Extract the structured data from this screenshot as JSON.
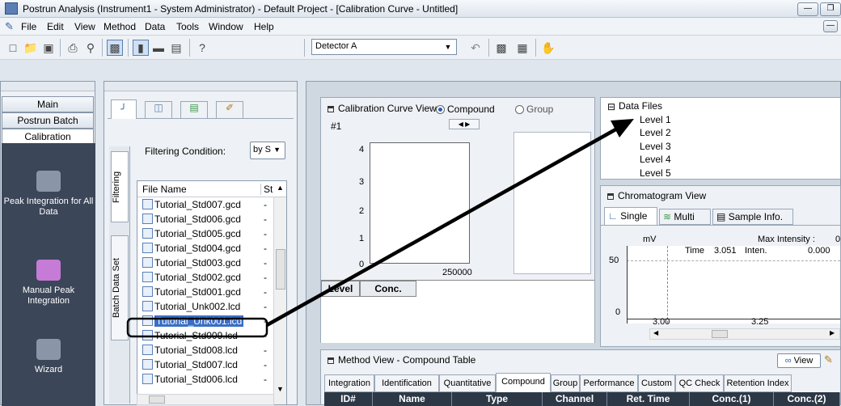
{
  "window": {
    "title": "Postrun Analysis (Instrument1 - System Administrator) - Default Project - [Calibration Curve - Untitled]"
  },
  "menu": [
    "File",
    "Edit",
    "View",
    "Method",
    "Data",
    "Tools",
    "Window",
    "Help"
  ],
  "toolbar": {
    "detector": "Detector A",
    "help": "?"
  },
  "nav": {
    "main": "Main",
    "postrun_batch": "Postrun Batch",
    "calibration": "Calibration",
    "items": [
      "Peak Integration for All Data",
      "Manual Peak Integration",
      "Wizard"
    ]
  },
  "filter": {
    "label": "Filtering Condition:",
    "value": "by S",
    "tab_filtering": "Filtering",
    "tab_batch": "Batch Data Set"
  },
  "files": {
    "col_name": "File Name",
    "col_st": "St",
    "rows": [
      {
        "name": "Tutorial_Std007.gcd",
        "st": "-"
      },
      {
        "name": "Tutorial_Std006.gcd",
        "st": "-"
      },
      {
        "name": "Tutorial_Std005.gcd",
        "st": "-"
      },
      {
        "name": "Tutorial_Std004.gcd",
        "st": "-"
      },
      {
        "name": "Tutorial_Std003.gcd",
        "st": "-"
      },
      {
        "name": "Tutorial_Std002.gcd",
        "st": "-"
      },
      {
        "name": "Tutorial_Std001.gcd",
        "st": "-"
      },
      {
        "name": "Tutorial_Unk002.lcd",
        "st": "-"
      },
      {
        "name": "Tutorial_Unk001.lcd",
        "st": "-"
      },
      {
        "name": "Tutorial_Std009.lcd",
        "st": "-"
      },
      {
        "name": "Tutorial_Std008.lcd",
        "st": "-"
      },
      {
        "name": "Tutorial_Std007.lcd",
        "st": "-"
      },
      {
        "name": "Tutorial_Std006.lcd",
        "st": "-"
      }
    ]
  },
  "calib": {
    "title": "Calibration Curve View",
    "compound": "Compound",
    "group": "Group",
    "id": "#1",
    "yticks": [
      "4",
      "3",
      "2",
      "1",
      "0"
    ],
    "xtick": "250000",
    "grid_level": "Level",
    "grid_conc": "Conc."
  },
  "tree": {
    "root": "Data Files",
    "levels": [
      "Level 1",
      "Level 2",
      "Level 3",
      "Level 4",
      "Level 5"
    ]
  },
  "chrom": {
    "title": "Chromatogram View",
    "tab_single": "Single",
    "tab_multi": "Multi",
    "tab_sample": "Sample Info.",
    "ylabel": "mV",
    "max_label": "Max Intensity :",
    "max_val": "0",
    "time_label": "Time",
    "time_val": "3.051",
    "inten_label": "Inten.",
    "inten_val": "0.000",
    "yticks": [
      "50",
      "0"
    ],
    "xticks": [
      "3.00",
      "3.25"
    ]
  },
  "method": {
    "title": "Method View - Compound Table",
    "view_btn": "View",
    "tabs": [
      "Integration",
      "Identification",
      "Quantitative",
      "Compound",
      "Group",
      "Performance",
      "Custom",
      "QC Check",
      "Retention Index"
    ],
    "columns": [
      "ID#",
      "Name",
      "Type",
      "Channel",
      "Ret. Time",
      "Conc.(1)",
      "Conc.(2)"
    ]
  }
}
